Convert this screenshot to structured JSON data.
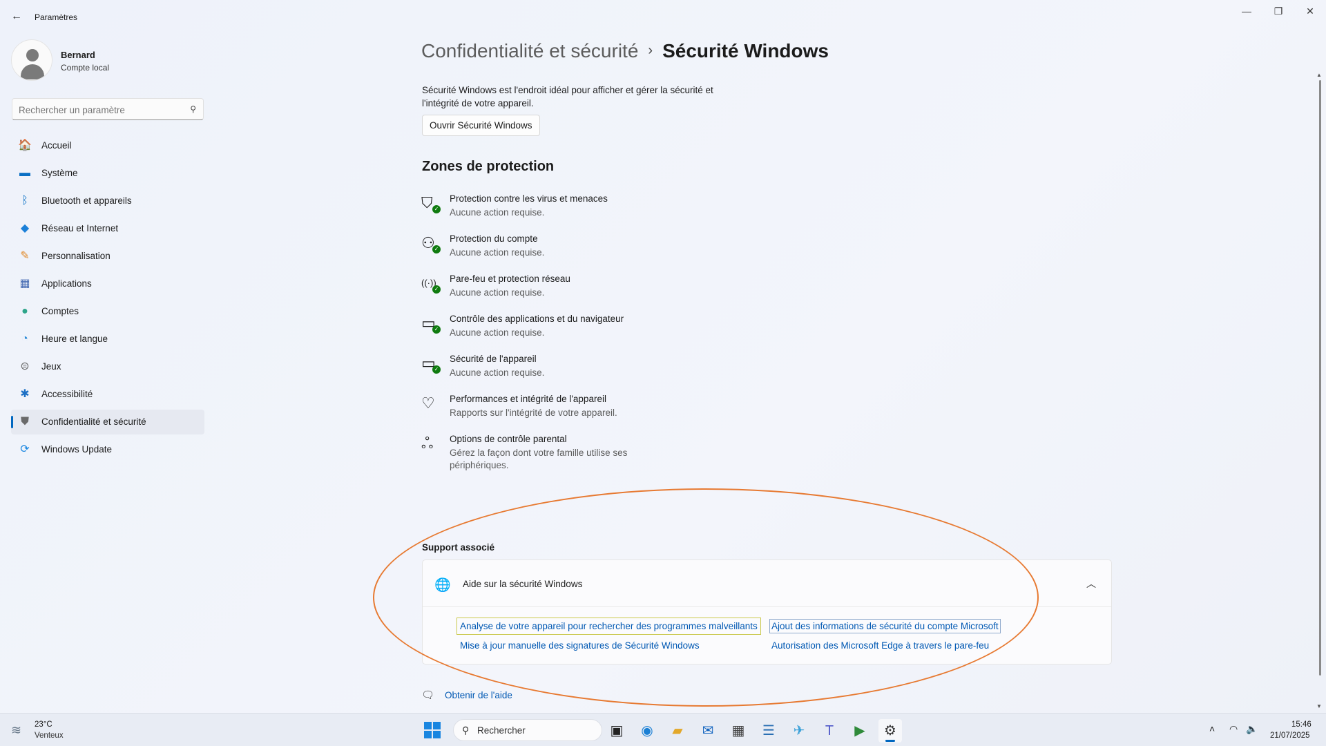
{
  "window": {
    "app_title": "Paramètres",
    "back": "←",
    "minimize": "—",
    "maximize": "❐",
    "close": "✕"
  },
  "profile": {
    "name": "Bernard",
    "subtitle": "Compte local"
  },
  "search": {
    "placeholder": "Rechercher un paramètre",
    "icon": "search-icon"
  },
  "sidebar": {
    "items": [
      {
        "label": "Accueil",
        "icon": "home-icon",
        "glyph": "🏠",
        "active": false
      },
      {
        "label": "Système",
        "icon": "monitor-icon",
        "glyph": "▬",
        "active": false
      },
      {
        "label": "Bluetooth et appareils",
        "icon": "bluetooth-icon",
        "glyph": "ᛒ",
        "active": false
      },
      {
        "label": "Réseau et Internet",
        "icon": "wifi-icon",
        "glyph": "◆",
        "active": false
      },
      {
        "label": "Personnalisation",
        "icon": "brush-icon",
        "glyph": "✎",
        "active": false
      },
      {
        "label": "Applications",
        "icon": "apps-icon",
        "glyph": "▦",
        "active": false
      },
      {
        "label": "Comptes",
        "icon": "person-icon",
        "glyph": "●",
        "active": false
      },
      {
        "label": "Heure et langue",
        "icon": "globe-clock-icon",
        "glyph": "◔",
        "active": false
      },
      {
        "label": "Jeux",
        "icon": "gamepad-icon",
        "glyph": "⊜",
        "active": false
      },
      {
        "label": "Accessibilité",
        "icon": "accessibility-icon",
        "glyph": "✱",
        "active": false
      },
      {
        "label": "Confidentialité et sécurité",
        "icon": "shield-icon",
        "glyph": "⛊",
        "active": true
      },
      {
        "label": "Windows Update",
        "icon": "update-icon",
        "glyph": "⟳",
        "active": false
      }
    ]
  },
  "main": {
    "breadcrumb_parent": "Confidentialité et sécurité",
    "breadcrumb_sep": "›",
    "breadcrumb_current": "Sécurité Windows",
    "description": "Sécurité Windows est l'endroit idéal pour afficher et gérer la sécurité et l'intégrité de votre appareil.",
    "open_button": "Ouvrir Sécurité Windows",
    "zones_title": "Zones de protection",
    "zones": [
      {
        "title": "Protection contre les virus et menaces",
        "subtitle": "Aucune action requise.",
        "icon": "virus-shield-icon",
        "glyph": "⛉",
        "check": true
      },
      {
        "title": "Protection du compte",
        "subtitle": "Aucune action requise.",
        "icon": "account-protection-icon",
        "glyph": "⚇",
        "check": true
      },
      {
        "title": "Pare-feu et protection réseau",
        "subtitle": "Aucune action requise.",
        "icon": "firewall-icon",
        "glyph": "((·))",
        "check": true
      },
      {
        "title": "Contrôle des applications et du navigateur",
        "subtitle": "Aucune action requise.",
        "icon": "app-browser-control-icon",
        "glyph": "▭",
        "check": true
      },
      {
        "title": "Sécurité de l'appareil",
        "subtitle": "Aucune action requise.",
        "icon": "device-security-icon",
        "glyph": "▭",
        "check": true
      },
      {
        "title": "Performances et intégrité de l'appareil",
        "subtitle": "Rapports sur l'intégrité de votre appareil.",
        "icon": "heart-pulse-icon",
        "glyph": "♡",
        "check": false
      },
      {
        "title": "Options de contrôle parental",
        "subtitle": "Gérez la façon dont votre famille utilise ses périphériques.",
        "icon": "family-icon",
        "glyph": "ஃ",
        "check": false
      }
    ],
    "support_label": "Support associé",
    "support_title": "Aide sur la sécurité Windows",
    "support_links": [
      "Analyse de votre appareil pour rechercher des programmes malveillants",
      "Ajout des informations de sécurité du compte Microsoft",
      "Mise à jour manuelle des signatures de Sécurité Windows",
      "Autorisation des Microsoft Edge à travers le pare-feu"
    ],
    "help_link": "Obtenir de l'aide"
  },
  "taskbar": {
    "weather_temp": "23°C",
    "weather_desc": "Venteux",
    "search_label": "Rechercher",
    "apps": [
      {
        "icon": "task-view-icon",
        "glyph": "▣",
        "active": false
      },
      {
        "icon": "edge-icon",
        "glyph": "◉",
        "active": false
      },
      {
        "icon": "file-explorer-icon",
        "glyph": "▰",
        "active": false
      },
      {
        "icon": "outlook-icon",
        "glyph": "✉",
        "active": false
      },
      {
        "icon": "calculator-icon",
        "glyph": "▦",
        "active": false
      },
      {
        "icon": "notepad-icon",
        "glyph": "☰",
        "active": false
      },
      {
        "icon": "maps-icon",
        "glyph": "✈",
        "active": false
      },
      {
        "icon": "teams-icon",
        "glyph": "T",
        "active": false
      },
      {
        "icon": "media-player-icon",
        "glyph": "▶",
        "active": false
      },
      {
        "icon": "settings-icon",
        "glyph": "⚙",
        "active": true
      }
    ],
    "time": "15:46",
    "date": "21/07/2025"
  },
  "colors": {
    "accent": "#0067c0",
    "link": "#0058b3",
    "check_green": "#0f7b0f",
    "annotation_ellipse": "#e77a32"
  }
}
